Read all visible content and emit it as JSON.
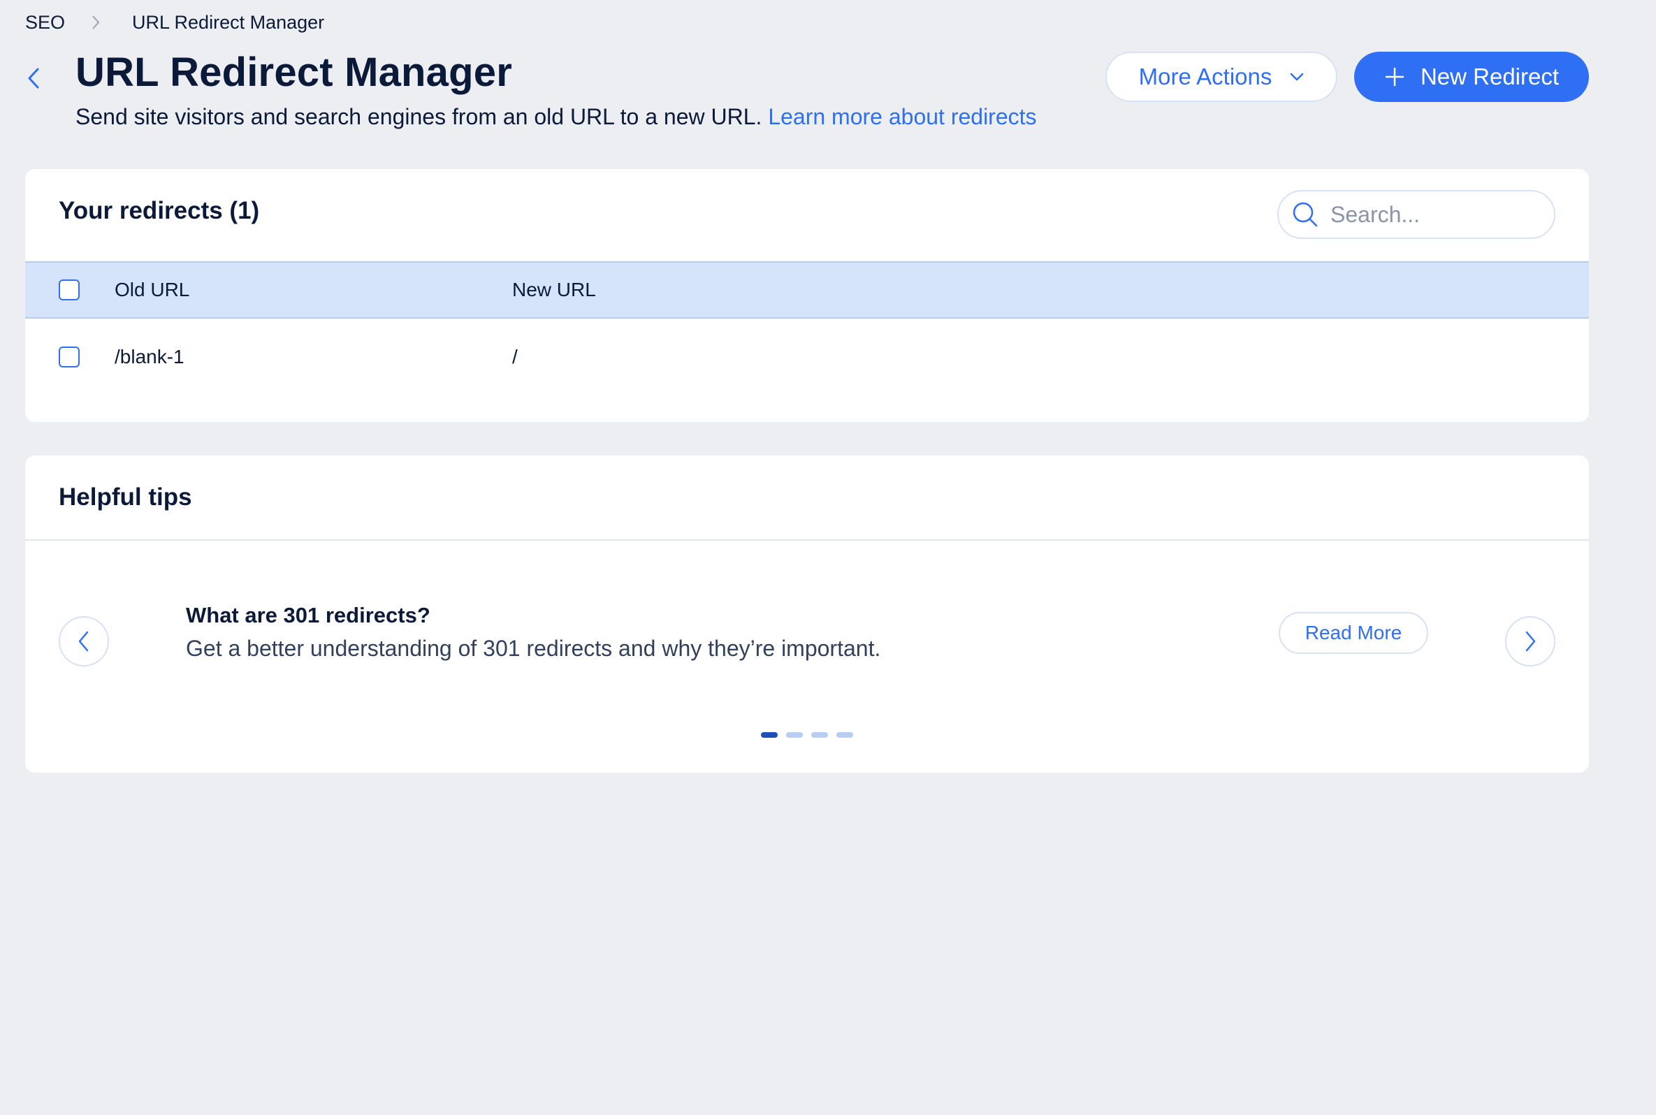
{
  "breadcrumb": {
    "root": "SEO",
    "current": "URL Redirect Manager"
  },
  "header": {
    "title": "URL Redirect Manager",
    "subtitle": "Send site visitors and search engines from an old URL to a new URL.",
    "learn_link": "Learn more about redirects",
    "more_actions_label": "More Actions",
    "new_redirect_label": "New Redirect"
  },
  "redirects": {
    "title": "Your redirects (1)",
    "search_placeholder": "Search...",
    "columns": {
      "old_url": "Old URL",
      "new_url": "New URL"
    },
    "rows": [
      {
        "old_url": "/blank-1",
        "new_url": "/"
      }
    ]
  },
  "tips": {
    "title": "Helpful tips",
    "item_title": "What are 301 redirects?",
    "item_description": "Get a better understanding of 301 redirects and why they’re important.",
    "read_more_label": "Read More",
    "page_count": 4,
    "active_page": 1
  },
  "colors": {
    "accent": "#2f6ff3",
    "background": "#edeef2",
    "table_header": "#d6e4fb",
    "dot_active": "#1d4fb8",
    "dot_inactive": "#b8cdf2"
  },
  "icons": {
    "breadcrumb_separator": "chevron-right-icon",
    "back": "chevron-left-icon",
    "more_actions": "chevron-down-icon",
    "new_redirect": "plus-icon",
    "search": "search-icon",
    "prev": "chevron-left-icon",
    "next": "chevron-right-icon"
  }
}
